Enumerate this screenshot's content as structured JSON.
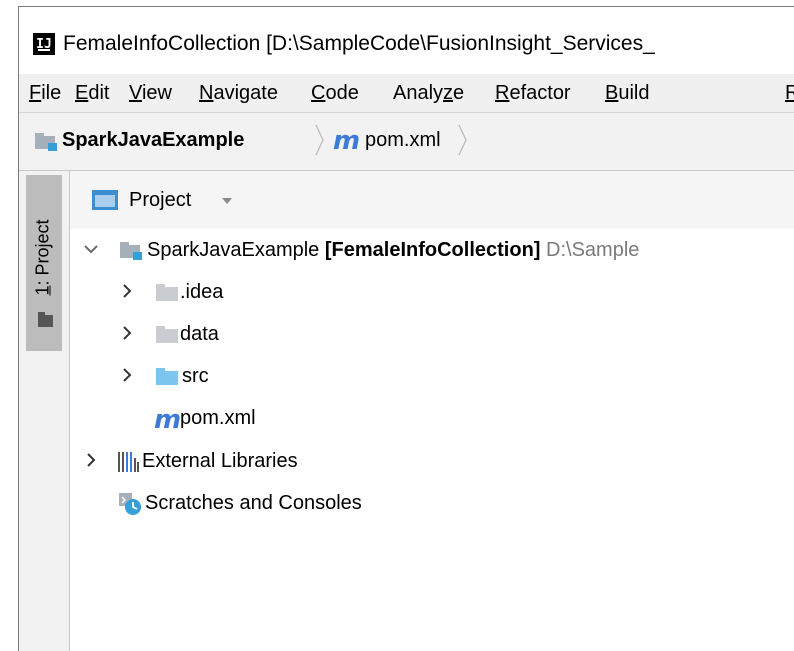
{
  "window": {
    "title": "FemaleInfoCollection [D:\\SampleCode\\FusionInsight_Services_",
    "app_icon": "intellij-idea-icon"
  },
  "menu": {
    "items": [
      {
        "mnemonic": "F",
        "rest": "ile"
      },
      {
        "mnemonic": "E",
        "rest": "dit"
      },
      {
        "mnemonic": "V",
        "rest": "iew"
      },
      {
        "mnemonic": "N",
        "rest": "avigate"
      },
      {
        "mnemonic": "C",
        "rest": "ode"
      },
      {
        "pre": "Analy",
        "mnemonic": "z",
        "rest": "e"
      },
      {
        "mnemonic": "R",
        "rest": "efactor"
      },
      {
        "mnemonic": "B",
        "rest": "uild"
      },
      {
        "mnemonic": "R",
        "rest": ""
      }
    ]
  },
  "breadcrumb": {
    "project": "SparkJavaExample",
    "file_icon": "m",
    "file": "pom.xml"
  },
  "toolwindow_tab": {
    "number": "1",
    "label": ": Project"
  },
  "panel": {
    "title": "Project",
    "dropdown_icon": "caret-down-icon"
  },
  "tree": {
    "root": {
      "name": "SparkJavaExample",
      "module": "[FemaleInfoCollection]",
      "path": "D:\\Sample"
    },
    "folders": [
      {
        "name": ".idea",
        "color": "#c9ccd0"
      },
      {
        "name": "data",
        "color": "#c9ccd0"
      },
      {
        "name": "src",
        "color": "#7cc5ef"
      }
    ],
    "pom": {
      "icon": "m",
      "name": "pom.xml"
    },
    "external": "External Libraries",
    "scratches": "Scratches and Consoles"
  },
  "colors": {
    "accent_blue": "#3d7bd6",
    "folder_grey": "#c9ccd0",
    "source_blue": "#7cc5ef",
    "path_grey": "#7a7a7a"
  }
}
